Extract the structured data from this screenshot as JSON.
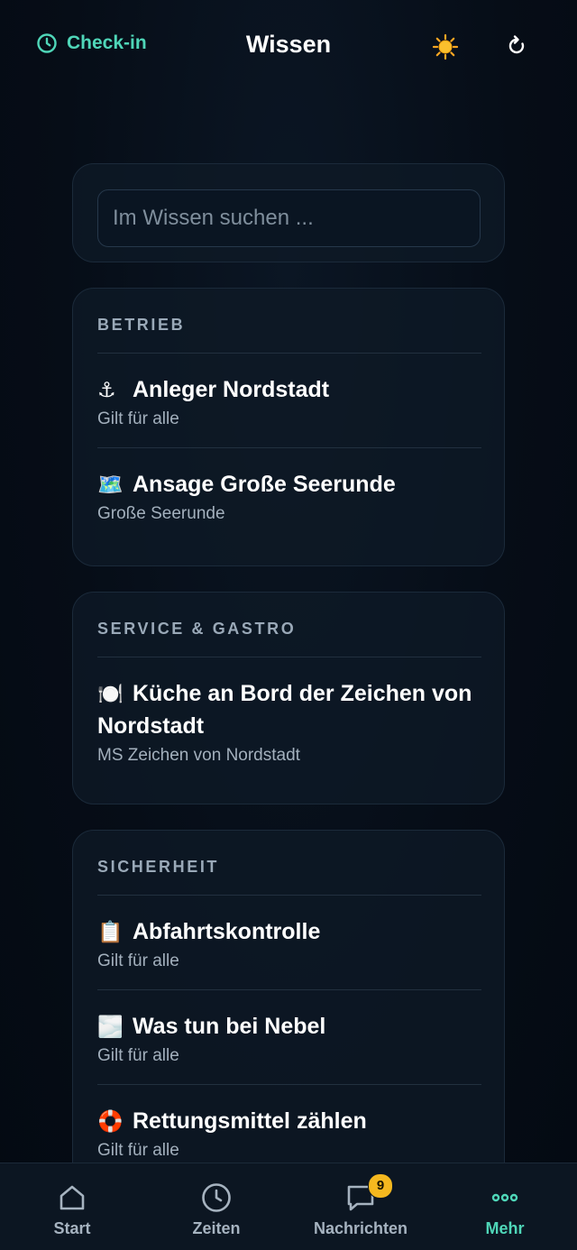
{
  "header": {
    "checkin_label": "Check-in",
    "title": "Wissen",
    "theme_icon": "sun-icon",
    "refresh_icon": "refresh-icon"
  },
  "search": {
    "placeholder": "Im Wissen suchen ...",
    "value": ""
  },
  "sections": [
    {
      "title": "BETRIEB",
      "items": [
        {
          "emoji": "⚓",
          "title": "Anleger Nordstadt",
          "subtitle": "Gilt für alle"
        },
        {
          "emoji": "🗺️",
          "title": "Ansage Große Seerunde",
          "subtitle": "Große Seerunde"
        }
      ]
    },
    {
      "title": "SERVICE & GASTRO",
      "items": [
        {
          "emoji": "🍽️",
          "title": "Küche an Bord der Zeichen von Nordstadt",
          "subtitle": "MS Zeichen von Nordstadt"
        }
      ]
    },
    {
      "title": "SICHERHEIT",
      "items": [
        {
          "emoji": "📋",
          "title": "Abfahrtskontrolle",
          "subtitle": "Gilt für alle"
        },
        {
          "emoji": "🌫️",
          "title": "Was tun bei Nebel",
          "subtitle": "Gilt für alle"
        },
        {
          "emoji": "🛟",
          "title": "Rettungsmittel zählen",
          "subtitle": "Gilt für alle"
        }
      ]
    }
  ],
  "bottom_nav": [
    {
      "label": "Start",
      "icon": "home-icon",
      "active": false
    },
    {
      "label": "Zeiten",
      "icon": "clock-icon",
      "active": false
    },
    {
      "label": "Nachrichten",
      "icon": "chat-icon",
      "active": false,
      "badge": "9"
    },
    {
      "label": "Mehr",
      "icon": "more-dots-icon",
      "active": true
    }
  ],
  "colors": {
    "accent": "#4fd6b8",
    "background": "#050b14",
    "card": "#0e1926",
    "badge": "#f5b81f"
  }
}
